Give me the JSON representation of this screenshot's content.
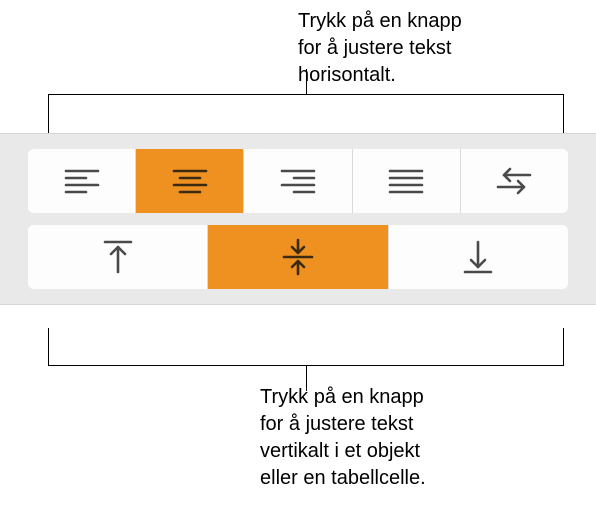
{
  "callouts": {
    "top": "Trykk på en knapp\nfor å justere tekst\nhorisontalt.",
    "bottom": "Trykk på en knapp\nfor å justere tekst\nvertikalt i et objekt\neller en tabellcelle."
  },
  "toolbar": {
    "horizontal": {
      "buttons": [
        {
          "name": "align-left",
          "selected": false
        },
        {
          "name": "align-center",
          "selected": true
        },
        {
          "name": "align-right",
          "selected": false
        },
        {
          "name": "align-justify",
          "selected": false
        },
        {
          "name": "align-bidi",
          "selected": false
        }
      ]
    },
    "vertical": {
      "buttons": [
        {
          "name": "valign-top",
          "selected": false
        },
        {
          "name": "valign-middle",
          "selected": true
        },
        {
          "name": "valign-bottom",
          "selected": false
        }
      ]
    }
  },
  "colors": {
    "accent": "#ee9121",
    "stroke_dark": "#4a4a4a",
    "stroke_dark_on_accent": "#3b2a12",
    "panel_bg": "#e9e9e9"
  }
}
